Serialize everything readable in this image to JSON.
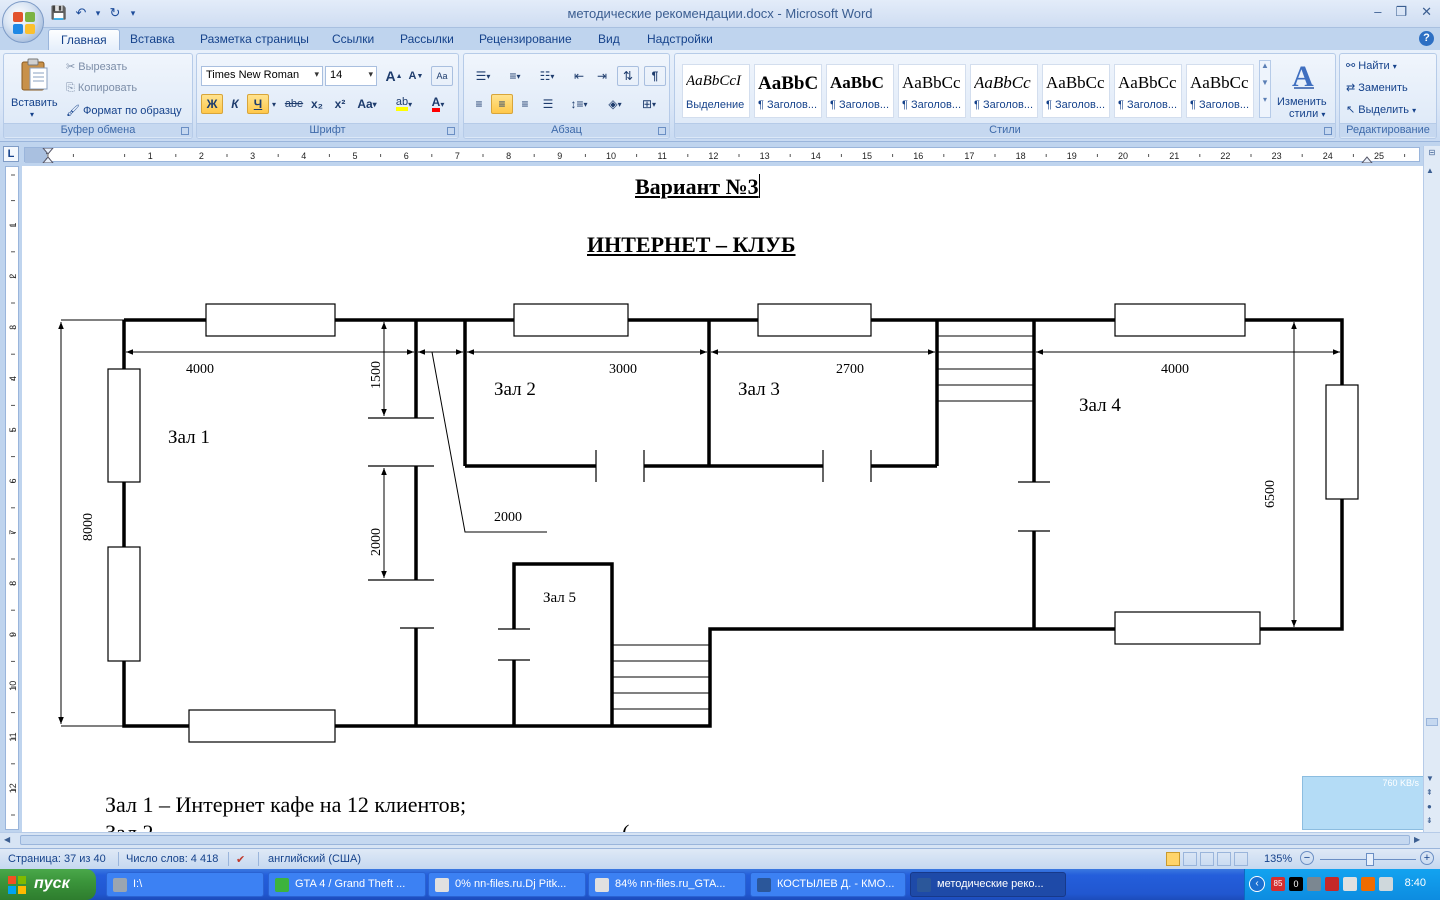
{
  "window": {
    "title": "методические рекомендации.docx - Microsoft Word"
  },
  "tabs": [
    "Главная",
    "Вставка",
    "Разметка страницы",
    "Ссылки",
    "Рассылки",
    "Рецензирование",
    "Вид",
    "Надстройки"
  ],
  "ribbon": {
    "clipboard": {
      "label": "Буфер обмена",
      "paste": "Вставить",
      "cut": "Вырезать",
      "copy": "Копировать",
      "format_painter": "Формат по образцу"
    },
    "font": {
      "label": "Шрифт",
      "font_name": "Times New Roman",
      "font_size": "14",
      "bold": "Ж",
      "italic": "К",
      "underline": "Ч",
      "strike": "abe",
      "subscript": "x₂",
      "superscript": "x²",
      "change_case": "Aa",
      "grow": "A",
      "shrink": "A"
    },
    "paragraph": {
      "label": "Абзац"
    },
    "styles": {
      "label": "Стили",
      "items": [
        {
          "sample": "AaBbCcI",
          "name": "Выделение"
        },
        {
          "sample": "AaBbC",
          "name": "¶ Заголов..."
        },
        {
          "sample": "AaBbC",
          "name": "¶ Заголов..."
        },
        {
          "sample": "AaBbCc",
          "name": "¶ Заголов..."
        },
        {
          "sample": "AaBbCc",
          "name": "¶ Заголов..."
        },
        {
          "sample": "AaBbCc",
          "name": "¶ Заголов..."
        },
        {
          "sample": "AaBbCc",
          "name": "¶ Заголов..."
        },
        {
          "sample": "AaBbCc",
          "name": "¶ Заголов..."
        }
      ],
      "change_styles_1": "Изменить",
      "change_styles_2": "стили"
    },
    "editing": {
      "label": "Редактирование",
      "find": "Найти",
      "replace": "Заменить",
      "select": "Выделить"
    }
  },
  "ruler": {
    "corner": "L",
    "h_ticks": [
      "1",
      "1",
      "2",
      "3",
      "4",
      "5",
      "6",
      "7",
      "8",
      "9",
      "10",
      "11",
      "12",
      "13",
      "14",
      "15",
      "16",
      "17",
      "18",
      "19",
      "20",
      "21",
      "22",
      "23",
      "24",
      "25",
      "26"
    ],
    "v_ticks": [
      "1",
      "2",
      "3",
      "4",
      "5",
      "6",
      "7",
      "8",
      "9",
      "10",
      "11",
      "12"
    ]
  },
  "document": {
    "variant": "Вариант №3",
    "title": "ИНТЕРНЕТ – КЛУБ",
    "plan": {
      "dims": {
        "d4000a": "4000",
        "d1500": "1500",
        "d3000": "3000",
        "d2700": "2700",
        "d4000b": "4000",
        "d8000": "8000",
        "d2000a": "2000",
        "d2000b": "2000",
        "d6500": "6500"
      },
      "rooms": {
        "r1": "Зал 1",
        "r2": "Зал 2",
        "r3": "Зал 3",
        "r4": "Зал 4",
        "r5": "Зал 5"
      }
    },
    "lines": [
      "Зал 1 – Интернет кафе на 12 клиентов;",
      "Зал 2"
    ],
    "lines_tail": "("
  },
  "network_widget": {
    "speed": "760 KB/s"
  },
  "status": {
    "page": "Страница: 37 из 40",
    "words": "Число слов: 4 418",
    "language": "английский (США)",
    "zoom": "135%"
  },
  "taskbar": {
    "start": "пуск",
    "tasks": [
      {
        "label": "I:\\"
      },
      {
        "label": "GTA 4 / Grand Theft ..."
      },
      {
        "label": "0% nn-files.ru.Dj Pitk..."
      },
      {
        "label": "84% nn-files.ru_GTA..."
      },
      {
        "label": "КОСТЫЛЕВ Д. - КМО..."
      },
      {
        "label": "методические реко..."
      }
    ],
    "tray_badge": "85",
    "tray_zero": "0",
    "clock": "8:40"
  }
}
